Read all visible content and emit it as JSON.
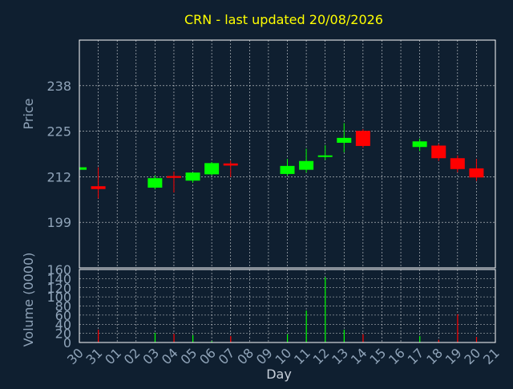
{
  "colors": {
    "background": "#0f1f30",
    "title": "#ffff00",
    "axis_text": "#8fa3b8",
    "frame": "#ffffff",
    "grid": "#ffffff",
    "up": "#00ff00",
    "down": "#ff0000"
  },
  "chart_data": [
    {
      "type": "candlestick",
      "title": "CRN - last updated 20/08/2026",
      "xlabel": "",
      "ylabel": "Price",
      "ylim": [
        186,
        251
      ],
      "yticks": [
        199,
        212,
        225,
        238
      ],
      "grid": true,
      "categories": [
        "30",
        "31",
        "01",
        "02",
        "03",
        "04",
        "05",
        "06",
        "07",
        "08",
        "09",
        "10",
        "11",
        "12",
        "13",
        "14",
        "15",
        "16",
        "17",
        "18",
        "19",
        "20",
        "21"
      ],
      "candles": [
        {
          "day": "30",
          "open": 214.0,
          "high": 214.5,
          "low": 213.7,
          "close": 214.7
        },
        {
          "day": "31",
          "open": 209.3,
          "high": 214.7,
          "low": 205.8,
          "close": 208.5
        },
        {
          "day": "03",
          "open": 208.9,
          "high": 212.4,
          "low": 208.4,
          "close": 211.6
        },
        {
          "day": "04",
          "open": 212.2,
          "high": 213.5,
          "low": 207.5,
          "close": 211.7
        },
        {
          "day": "05",
          "open": 210.9,
          "high": 213.1,
          "low": 210.3,
          "close": 213.2
        },
        {
          "day": "06",
          "open": 212.7,
          "high": 216.2,
          "low": 212.4,
          "close": 215.9
        },
        {
          "day": "07",
          "open": 215.8,
          "high": 216.6,
          "low": 211.9,
          "close": 215.2
        },
        {
          "day": "10",
          "open": 212.8,
          "high": 217.1,
          "low": 212.3,
          "close": 215.1
        },
        {
          "day": "11",
          "open": 214.0,
          "high": 220.0,
          "low": 213.2,
          "close": 216.5
        },
        {
          "day": "12",
          "open": 217.7,
          "high": 221.0,
          "low": 216.8,
          "close": 218.1
        },
        {
          "day": "13",
          "open": 221.7,
          "high": 227.3,
          "low": 219.0,
          "close": 223.1
        },
        {
          "day": "14",
          "open": 225.1,
          "high": 225.6,
          "low": 220.3,
          "close": 220.8
        },
        {
          "day": "17",
          "open": 220.5,
          "high": 222.9,
          "low": 219.3,
          "close": 222.1
        },
        {
          "day": "18",
          "open": 220.9,
          "high": 221.4,
          "low": 216.5,
          "close": 217.3
        },
        {
          "day": "19",
          "open": 217.3,
          "high": 218.1,
          "low": 213.3,
          "close": 214.2
        },
        {
          "day": "20",
          "open": 214.4,
          "high": 217.1,
          "low": 210.8,
          "close": 211.8
        }
      ]
    },
    {
      "type": "bar",
      "xlabel": "Day",
      "ylabel": "Volume (0000)",
      "ylim": [
        0,
        160
      ],
      "yticks": [
        0,
        20,
        40,
        60,
        80,
        100,
        120,
        140,
        160
      ],
      "grid": true,
      "categories": [
        "30",
        "31",
        "01",
        "02",
        "03",
        "04",
        "05",
        "06",
        "07",
        "08",
        "09",
        "10",
        "11",
        "12",
        "13",
        "14",
        "15",
        "16",
        "17",
        "18",
        "19",
        "20",
        "21"
      ],
      "bars": [
        {
          "day": "30",
          "value": 0,
          "direction": "up"
        },
        {
          "day": "31",
          "value": 28,
          "direction": "down"
        },
        {
          "day": "03",
          "value": 21,
          "direction": "up"
        },
        {
          "day": "04",
          "value": 19,
          "direction": "down"
        },
        {
          "day": "05",
          "value": 16,
          "direction": "up"
        },
        {
          "day": "06",
          "value": 3,
          "direction": "up"
        },
        {
          "day": "07",
          "value": 14,
          "direction": "down"
        },
        {
          "day": "10",
          "value": 18,
          "direction": "up"
        },
        {
          "day": "11",
          "value": 70,
          "direction": "up"
        },
        {
          "day": "12",
          "value": 143,
          "direction": "up"
        },
        {
          "day": "13",
          "value": 28,
          "direction": "up"
        },
        {
          "day": "14",
          "value": 18,
          "direction": "down"
        },
        {
          "day": "17",
          "value": 14,
          "direction": "up"
        },
        {
          "day": "18",
          "value": 6,
          "direction": "down"
        },
        {
          "day": "19",
          "value": 62,
          "direction": "down"
        },
        {
          "day": "20",
          "value": 12,
          "direction": "down"
        }
      ]
    }
  ]
}
